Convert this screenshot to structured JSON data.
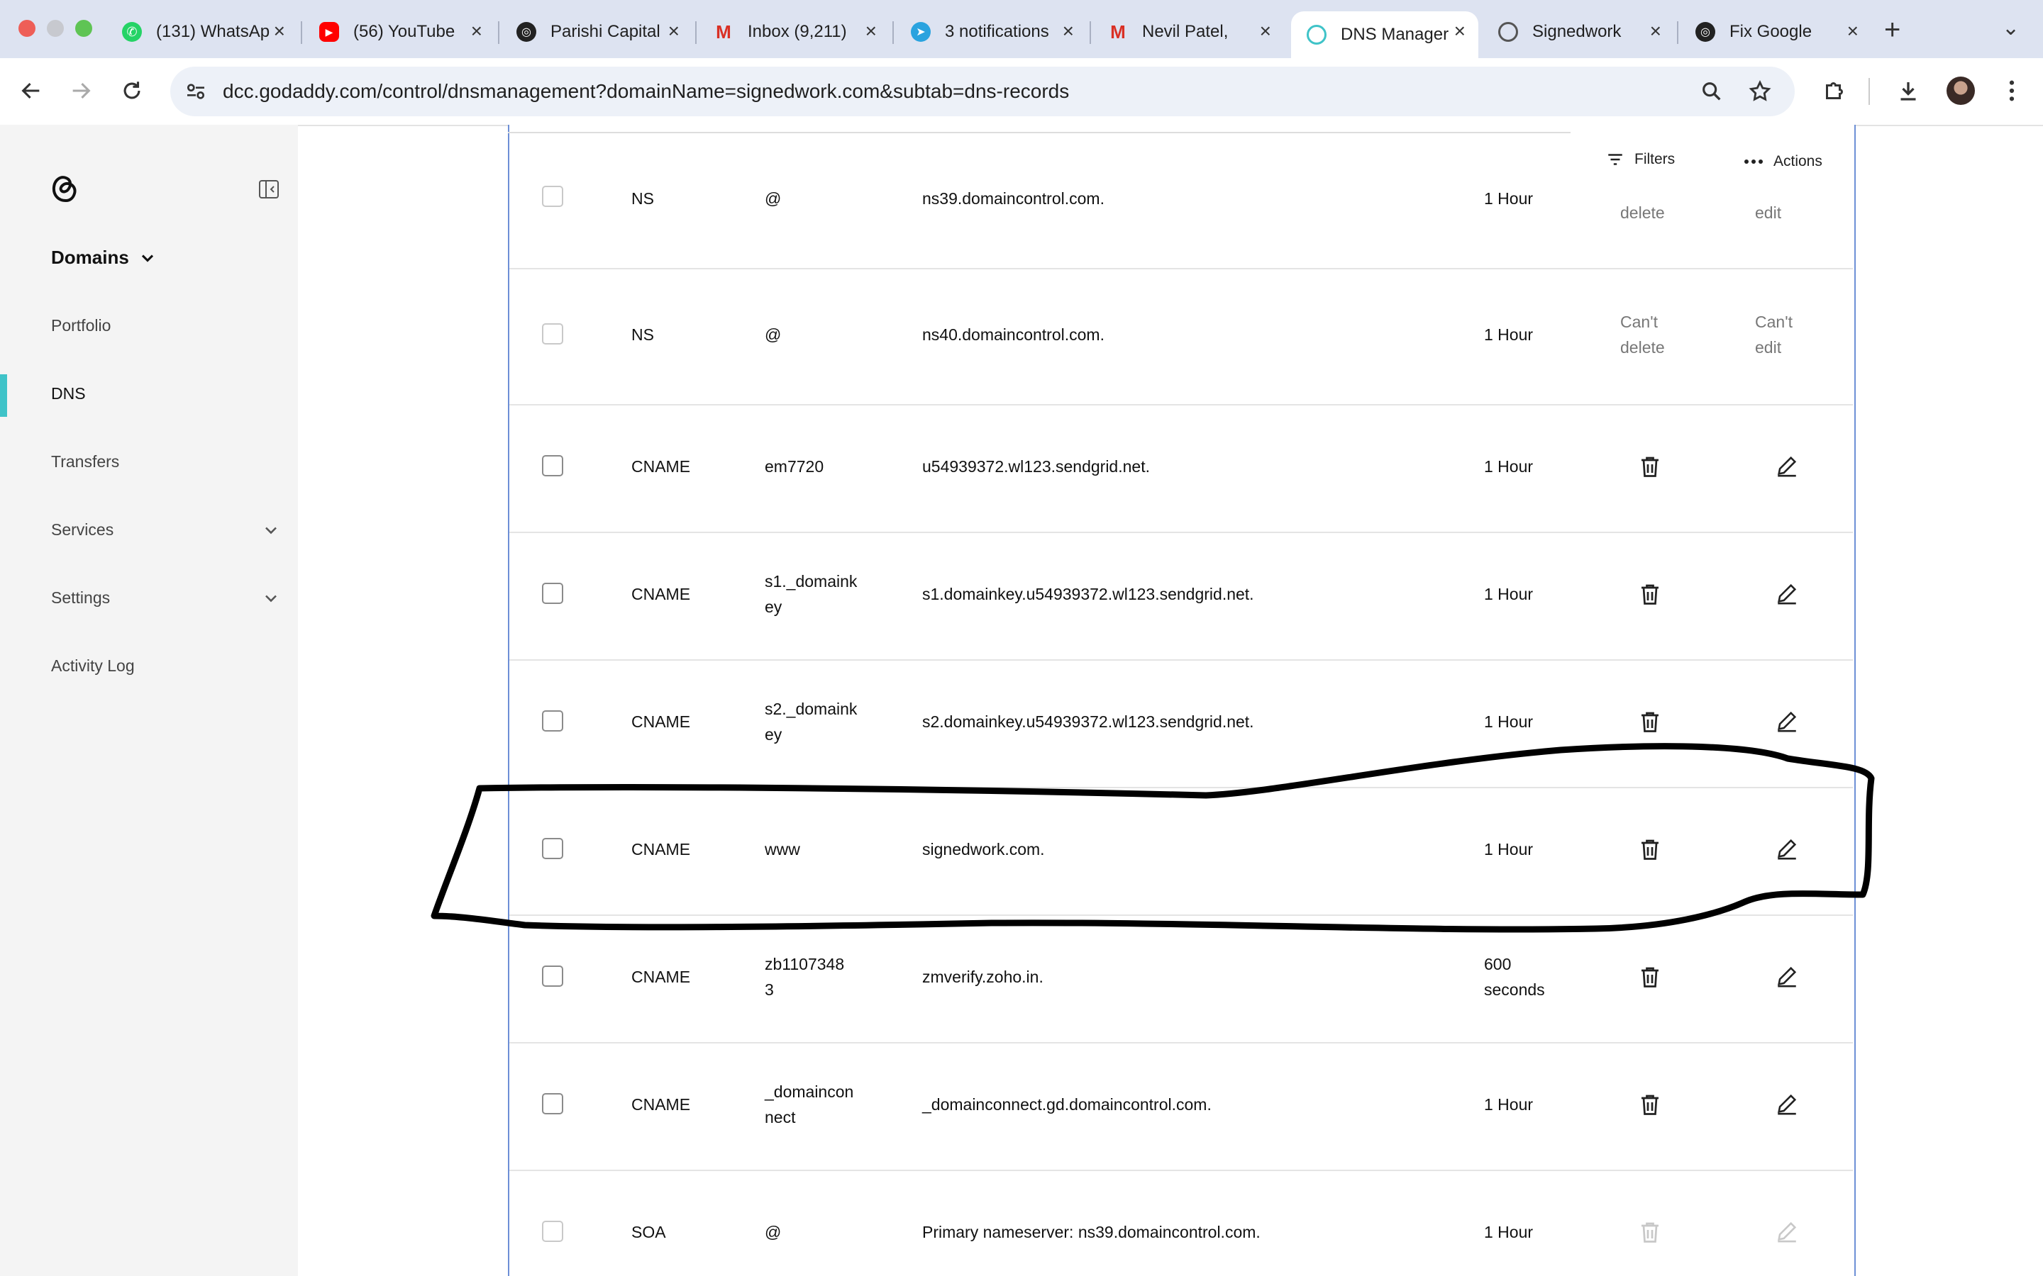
{
  "browser": {
    "tabs": [
      {
        "label": "(131) WhatsApp",
        "icon": "whatsapp-icon"
      },
      {
        "label": "(56) YouTube",
        "icon": "youtube-icon"
      },
      {
        "label": "Parishi Capital",
        "icon": "openai-icon"
      },
      {
        "label": "Inbox (9,211)",
        "icon": "gmail-icon"
      },
      {
        "label": "3 notifications",
        "icon": "telegram-icon"
      },
      {
        "label": "Nevil Patel,",
        "icon": "gmail-icon"
      },
      {
        "label": "DNS Manager",
        "icon": "godaddy-icon",
        "active": true
      },
      {
        "label": "Signedwork",
        "icon": "globe-icon"
      },
      {
        "label": "Fix Google",
        "icon": "openai-icon"
      }
    ],
    "url": "dcc.godaddy.com/control/dnsmanagement?domainName=signedwork.com&subtab=dns-records"
  },
  "sidebar": {
    "section": "Domains",
    "items": [
      {
        "label": "Portfolio"
      },
      {
        "label": "DNS",
        "active": true
      },
      {
        "label": "Transfers"
      },
      {
        "label": "Services",
        "expandable": true
      },
      {
        "label": "Settings",
        "expandable": true
      },
      {
        "label": "Activity Log"
      }
    ]
  },
  "toolbar": {
    "filters_label": "Filters",
    "actions_label": "Actions"
  },
  "records": [
    {
      "type": "NS",
      "name": "@",
      "value": "ns39.domaincontrol.com.",
      "ttl": "1 Hour",
      "delete": "delete",
      "edit": "edit"
    },
    {
      "type": "NS",
      "name": "@",
      "value": "ns40.domaincontrol.com.",
      "ttl": "1 Hour",
      "delete": "Can't delete",
      "edit": "Can't edit"
    },
    {
      "type": "CNAME",
      "name": "em7720",
      "value": "u54939372.wl123.sendgrid.net.",
      "ttl": "1 Hour"
    },
    {
      "type": "CNAME",
      "name": "s1._domainkey",
      "value": "s1.domainkey.u54939372.wl123.sendgrid.net.",
      "ttl": "1 Hour"
    },
    {
      "type": "CNAME",
      "name": "s2._domainkey",
      "value": "s2.domainkey.u54939372.wl123.sendgrid.net.",
      "ttl": "1 Hour"
    },
    {
      "type": "CNAME",
      "name": "www",
      "value": "signedwork.com.",
      "ttl": "1 Hour",
      "highlighted": true
    },
    {
      "type": "CNAME",
      "name": "zb11073483",
      "value": "zmverify.zoho.in.",
      "ttl": "600 seconds"
    },
    {
      "type": "CNAME",
      "name": "_domainconnect",
      "value": "_domainconnect.gd.domaincontrol.com.",
      "ttl": "1 Hour"
    },
    {
      "type": "SOA",
      "name": "@",
      "value": "Primary nameserver: ns39.domaincontrol.com.",
      "ttl": "1 Hour",
      "disabled": true
    }
  ],
  "colors": {
    "accent": "#3fc3c8",
    "frame": "#6d8fd6",
    "tabstrip": "#dde3f1"
  }
}
